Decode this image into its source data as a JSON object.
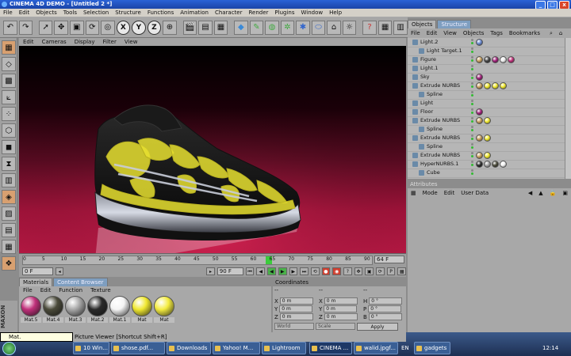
{
  "window": {
    "title": "CINEMA 4D DEMO - [Untitled 2 *]",
    "controls": [
      "_",
      "□",
      "x"
    ]
  },
  "menubar": [
    "File",
    "Edit",
    "Objects",
    "Tools",
    "Selection",
    "Structure",
    "Functions",
    "Animation",
    "Character",
    "Render",
    "Plugins",
    "Window",
    "Help"
  ],
  "toolbar": {
    "axis_buttons": [
      "X",
      "Y",
      "Z"
    ]
  },
  "viewport": {
    "menu": [
      "Edit",
      "Cameras",
      "Display",
      "Filter",
      "View"
    ]
  },
  "timeline": {
    "ticks": [
      "0",
      "5",
      "10",
      "15",
      "20",
      "25",
      "30",
      "35",
      "40",
      "45",
      "50",
      "55",
      "60",
      "65",
      "70",
      "75",
      "80",
      "85",
      "90"
    ],
    "current_frame": "0 F",
    "end_frame": "90 F",
    "frame_display": "64 F",
    "playhead_frame": 64
  },
  "materials": {
    "tabs": [
      "Materials",
      "Content Browser"
    ],
    "menu": [
      "File",
      "Edit",
      "Function",
      "Texture"
    ],
    "items": [
      {
        "label": "Mat.5",
        "color": "#c0307a"
      },
      {
        "label": "Mat.4",
        "color": "#4a4a3a"
      },
      {
        "label": "Mat.3",
        "color": "#a8a8a8"
      },
      {
        "label": "Mat.2",
        "color": "#2a2a2a"
      },
      {
        "label": "Mat.1",
        "color": "#f4f4f4"
      },
      {
        "label": "Mat",
        "color": "#f0e830"
      },
      {
        "label": "Mat",
        "color": "#f4ec40"
      }
    ]
  },
  "coordinates": {
    "title": "Coordinates",
    "headers": [
      "--",
      "--",
      "--"
    ],
    "rows": [
      [
        {
          "axis": "X",
          "value": "0 m"
        },
        {
          "axis": "X",
          "value": "0 m"
        },
        {
          "axis": "H",
          "value": "0 °"
        }
      ],
      [
        {
          "axis": "Y",
          "value": "0 m"
        },
        {
          "axis": "Y",
          "value": "0 m"
        },
        {
          "axis": "P",
          "value": "0 °"
        }
      ],
      [
        {
          "axis": "Z",
          "value": "0 m"
        },
        {
          "axis": "Z",
          "value": "0 m"
        },
        {
          "axis": "B",
          "value": "0 °"
        }
      ]
    ],
    "mode_select": "World",
    "size_select": "Scale",
    "apply_label": "Apply"
  },
  "objects": {
    "tabs": [
      "Objects",
      "Structure"
    ],
    "menu": [
      "File",
      "Edit",
      "View",
      "Objects",
      "Tags",
      "Bookmarks"
    ],
    "items": [
      {
        "name": "Light.2",
        "indent": 0,
        "tags": [
          "#6a8ad0"
        ]
      },
      {
        "name": "Light Target.1",
        "indent": 1,
        "tags": []
      },
      {
        "name": "Figure",
        "indent": 0,
        "tags": [
          "#c8a060",
          "#444",
          "#a0207a",
          "#eee",
          "#c0307a"
        ]
      },
      {
        "name": "Light.1",
        "indent": 0,
        "tags": []
      },
      {
        "name": "Sky",
        "indent": 0,
        "tags": [
          "#a0207a"
        ]
      },
      {
        "name": "Extrude NURBS",
        "indent": 0,
        "tags": [
          "#c8a060",
          "#f0e830",
          "#f0e830",
          "#f0e830"
        ]
      },
      {
        "name": "Spline",
        "indent": 1,
        "tags": []
      },
      {
        "name": "Light",
        "indent": 0,
        "tags": []
      },
      {
        "name": "Floor",
        "indent": 0,
        "tags": [
          "#a0207a"
        ]
      },
      {
        "name": "Extrude NURBS",
        "indent": 0,
        "tags": [
          "#c8a060",
          "#f0e830"
        ]
      },
      {
        "name": "Spline",
        "indent": 1,
        "tags": []
      },
      {
        "name": "Extrude NURBS",
        "indent": 0,
        "tags": [
          "#c8a060",
          "#f0e830"
        ]
      },
      {
        "name": "Spline",
        "indent": 1,
        "tags": []
      },
      {
        "name": "Extrude NURBS",
        "indent": 0,
        "tags": [
          "#c8a060",
          "#f0e830"
        ]
      },
      {
        "name": "HyperNURBS.1",
        "indent": 0,
        "tags": [
          "#2a2a2a",
          "#a8a8a8",
          "#4a4a3a",
          "#f4f4f4"
        ]
      },
      {
        "name": "Cube",
        "indent": 1,
        "tags": []
      }
    ]
  },
  "attributes": {
    "title": "Attributes",
    "menu": [
      "Mode",
      "Edit",
      "User Data"
    ]
  },
  "statusbar": {
    "text": "Picture Viewer [Shortcut Shift+R]"
  },
  "taskbar": {
    "tooltip": "Mat.",
    "tasks": [
      "10 Win...",
      "shose.pdf...",
      "Downloads",
      "Yahoo! M...",
      "Lightroom",
      "CINEMA ...",
      "walid.jpgf...",
      "gadgets"
    ],
    "language": "EN",
    "clock": "12:14"
  },
  "colors": {
    "titlebar": "#2a62d6",
    "viewport_floor": "#c81a4a",
    "shoe_accent": "#e8e030"
  }
}
